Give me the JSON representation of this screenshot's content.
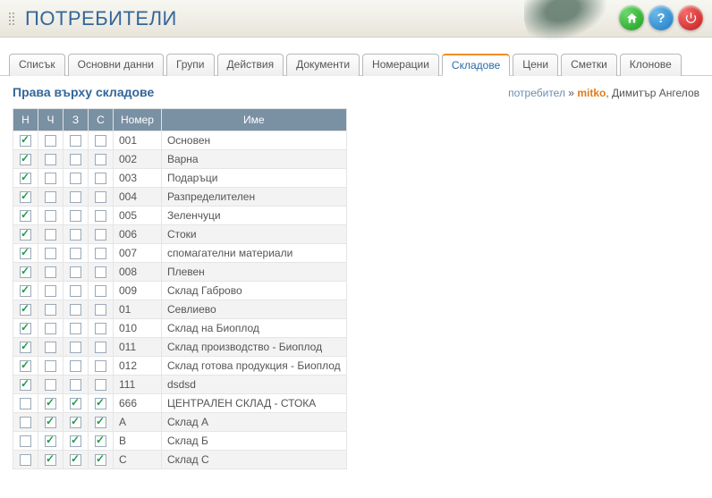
{
  "header": {
    "title": "ПОТРЕБИТЕЛИ"
  },
  "tabs": [
    {
      "label": "Списък",
      "active": false
    },
    {
      "label": "Основни данни",
      "active": false
    },
    {
      "label": "Групи",
      "active": false
    },
    {
      "label": "Действия",
      "active": false
    },
    {
      "label": "Документи",
      "active": false
    },
    {
      "label": "Номерации",
      "active": false
    },
    {
      "label": "Складове",
      "active": true
    },
    {
      "label": "Цени",
      "active": false
    },
    {
      "label": "Сметки",
      "active": false
    },
    {
      "label": "Клонове",
      "active": false
    }
  ],
  "section": {
    "title": "Права върху складове"
  },
  "user": {
    "prefix": "потребител",
    "sep": " » ",
    "login": "mitko",
    "name": ", Димитър Ангелов"
  },
  "columns": [
    "Н",
    "Ч",
    "З",
    "С",
    "Номер",
    "Име"
  ],
  "rows": [
    {
      "n": true,
      "c": false,
      "z": false,
      "s": false,
      "num": "001",
      "name": "Основен"
    },
    {
      "n": true,
      "c": false,
      "z": false,
      "s": false,
      "num": "002",
      "name": "Варна"
    },
    {
      "n": true,
      "c": false,
      "z": false,
      "s": false,
      "num": "003",
      "name": "Подаръци"
    },
    {
      "n": true,
      "c": false,
      "z": false,
      "s": false,
      "num": "004",
      "name": "Разпределителен"
    },
    {
      "n": true,
      "c": false,
      "z": false,
      "s": false,
      "num": "005",
      "name": "Зеленчуци"
    },
    {
      "n": true,
      "c": false,
      "z": false,
      "s": false,
      "num": "006",
      "name": "Стоки"
    },
    {
      "n": true,
      "c": false,
      "z": false,
      "s": false,
      "num": "007",
      "name": "спомагателни материали"
    },
    {
      "n": true,
      "c": false,
      "z": false,
      "s": false,
      "num": "008",
      "name": "Плевен"
    },
    {
      "n": true,
      "c": false,
      "z": false,
      "s": false,
      "num": "009",
      "name": "Склад Габрово"
    },
    {
      "n": true,
      "c": false,
      "z": false,
      "s": false,
      "num": "01",
      "name": "Севлиево"
    },
    {
      "n": true,
      "c": false,
      "z": false,
      "s": false,
      "num": "010",
      "name": "Склад на Биоплод"
    },
    {
      "n": true,
      "c": false,
      "z": false,
      "s": false,
      "num": "011",
      "name": "Склад производство - Биоплод"
    },
    {
      "n": true,
      "c": false,
      "z": false,
      "s": false,
      "num": "012",
      "name": "Склад готова продукция - Биоплод"
    },
    {
      "n": true,
      "c": false,
      "z": false,
      "s": false,
      "num": "111",
      "name": "dsdsd"
    },
    {
      "n": false,
      "c": true,
      "z": true,
      "s": true,
      "num": "666",
      "name": "ЦЕНТРАЛЕН СКЛАД - СТОКА"
    },
    {
      "n": false,
      "c": true,
      "z": true,
      "s": true,
      "num": "A",
      "name": "Склад А"
    },
    {
      "n": false,
      "c": true,
      "z": true,
      "s": true,
      "num": "B",
      "name": "Склад Б"
    },
    {
      "n": false,
      "c": true,
      "z": true,
      "s": true,
      "num": "C",
      "name": "Склад С"
    }
  ]
}
